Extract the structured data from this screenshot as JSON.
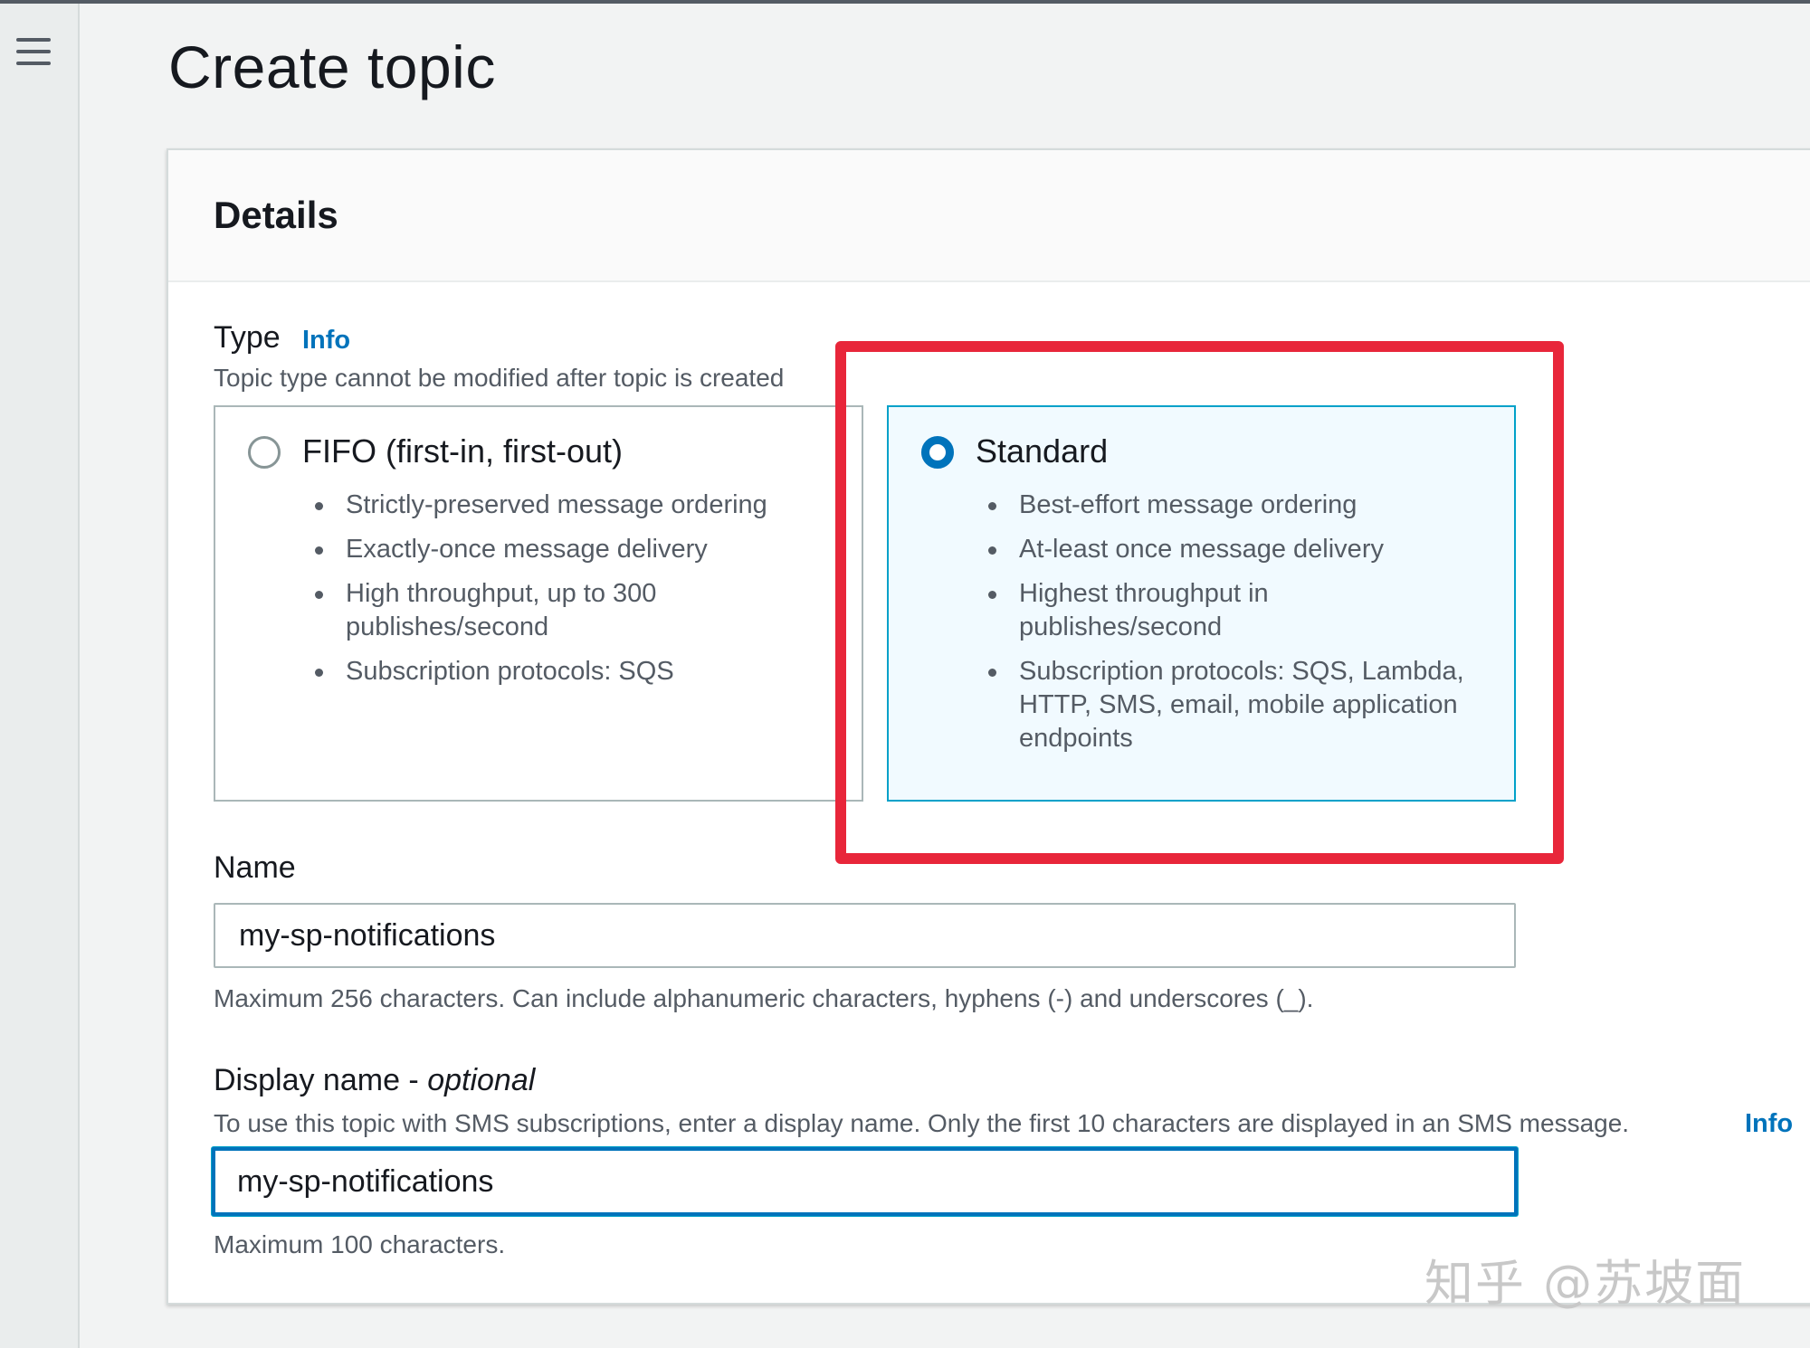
{
  "page": {
    "title": "Create topic"
  },
  "details": {
    "title": "Details",
    "type": {
      "label": "Type",
      "info": "Info",
      "description": "Topic type cannot be modified after topic is created",
      "options": [
        {
          "title": "FIFO (first-in, first-out)",
          "selected": false,
          "bullets": [
            "Strictly-preserved message ordering",
            "Exactly-once message delivery",
            "High throughput, up to 300 publishes/second",
            "Subscription protocols: SQS"
          ]
        },
        {
          "title": "Standard",
          "selected": true,
          "bullets": [
            "Best-effort message ordering",
            "At-least once message delivery",
            "Highest throughput in publishes/second",
            "Subscription protocols: SQS, Lambda, HTTP, SMS, email, mobile application endpoints"
          ]
        }
      ]
    },
    "name": {
      "label": "Name",
      "value": "my-sp-notifications",
      "hint": "Maximum 256 characters. Can include alphanumeric characters, hyphens (-) and underscores (_)."
    },
    "display_name": {
      "label": "Display name - ",
      "label_optional": "optional",
      "description": "To use this topic with SMS subscriptions, enter a display name. Only the first 10 characters are displayed in an SMS message.",
      "info": "Info",
      "value": "my-sp-notifications",
      "hint": "Maximum 100 characters."
    }
  },
  "watermark": "知乎 @苏坡面",
  "colors": {
    "accent": "#0073bb",
    "selected_border": "#00a1c9",
    "highlight": "#e8263a"
  }
}
